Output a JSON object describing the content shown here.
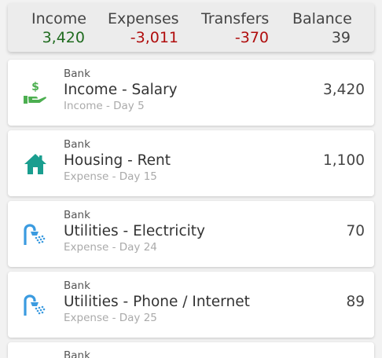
{
  "summary": {
    "income": {
      "label": "Income",
      "value": "3,420",
      "color": "#1f6b1f"
    },
    "expenses": {
      "label": "Expenses",
      "value": "-3,011",
      "color": "#b00d0d"
    },
    "transfers": {
      "label": "Transfers",
      "value": "-370",
      "color": "#b00d0d"
    },
    "balance": {
      "label": "Balance",
      "value": "39",
      "color": "#444444"
    }
  },
  "items": [
    {
      "account": "Bank",
      "name": "Income - Salary",
      "sub": "Income - Day 5",
      "amount": "3,420",
      "icon": "salary-hand-icon",
      "icon_color": "#4caf50"
    },
    {
      "account": "Bank",
      "name": "Housing - Rent",
      "sub": "Expense - Day 15",
      "amount": "1,100",
      "icon": "house-icon",
      "icon_color": "#1a9e8f"
    },
    {
      "account": "Bank",
      "name": "Utilities - Electricity",
      "sub": "Expense - Day 24",
      "amount": "70",
      "icon": "shower-icon",
      "icon_color": "#3b9be0"
    },
    {
      "account": "Bank",
      "name": "Utilities - Phone / Internet",
      "sub": "Expense - Day 25",
      "amount": "89",
      "icon": "shower-icon",
      "icon_color": "#3b9be0"
    },
    {
      "account": "Bank"
    }
  ]
}
